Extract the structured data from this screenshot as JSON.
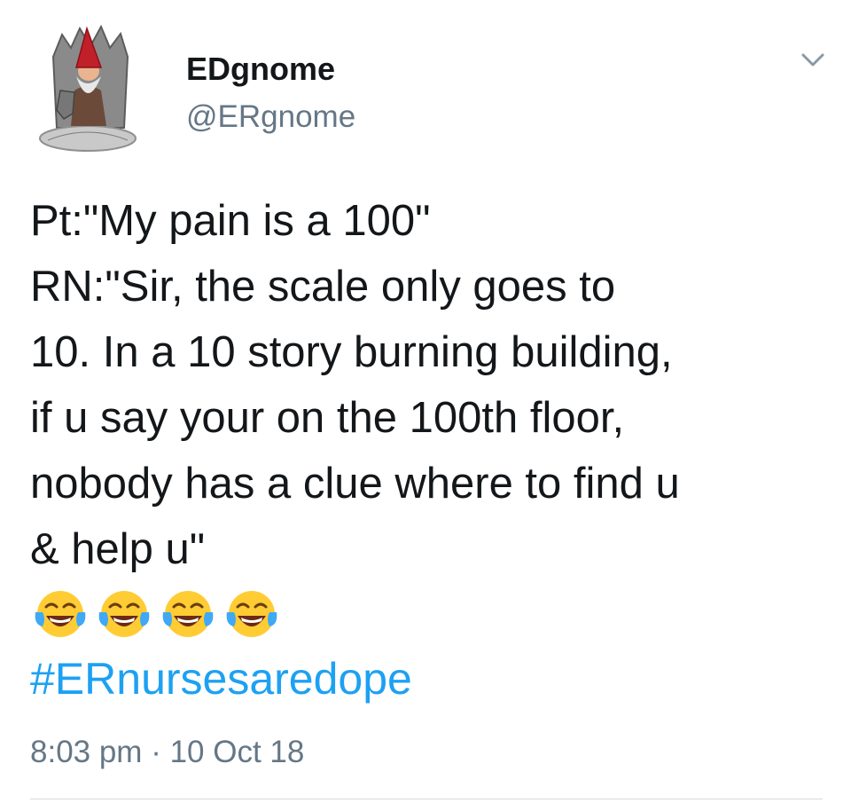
{
  "user": {
    "display_name": "EDgnome",
    "handle": "@ERgnome",
    "avatar_icon": "gnome-on-throne-avatar"
  },
  "tweet": {
    "lines": [
      "Pt:\"My pain is a 100\"",
      "RN:\"Sir, the scale only goes to",
      "10. In a 10 story burning building,",
      "if u say your on the 100th floor,",
      "nobody has a clue where to find u",
      "& help u\""
    ],
    "emoji": [
      "face-with-tears-of-joy",
      "face-with-tears-of-joy",
      "face-with-tears-of-joy",
      "face-with-tears-of-joy"
    ],
    "hashtag": "#ERnursesaredope",
    "timestamp": "8:03 pm · 10 Oct 18"
  },
  "colors": {
    "text": "#14171a",
    "secondary": "#657786",
    "link": "#1da1f2",
    "emoji_face": "#ffcc33",
    "tears": "#3fa9f5"
  },
  "icons": {
    "menu_caret": "chevron-down-icon"
  }
}
